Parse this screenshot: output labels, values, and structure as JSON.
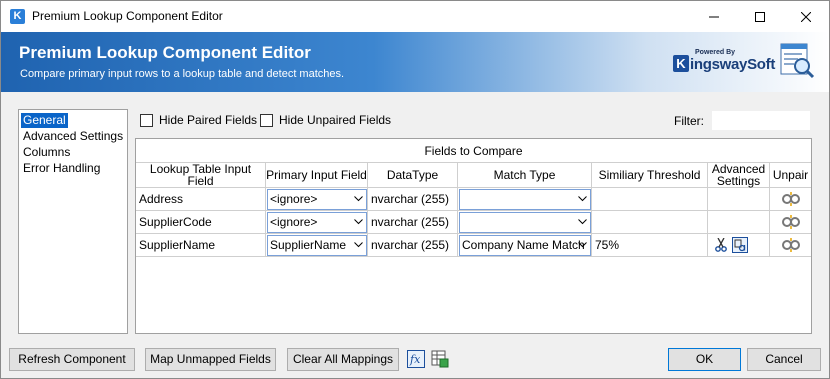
{
  "window": {
    "title": "Premium Lookup Component Editor",
    "app_icon_letter": "K"
  },
  "banner": {
    "title": "Premium Lookup Component Editor",
    "subtitle": "Compare primary input rows to a lookup table and detect matches.",
    "brand_powered": "Powered By",
    "brand_k": "K",
    "brand_name": "ingswaySoft"
  },
  "nav": {
    "items": [
      {
        "label": "General",
        "selected": true
      },
      {
        "label": "Advanced Settings",
        "selected": false
      },
      {
        "label": "Columns",
        "selected": false
      },
      {
        "label": "Error Handling",
        "selected": false
      }
    ]
  },
  "options": {
    "hide_paired_label": "Hide Paired Fields",
    "hide_unpaired_label": "Hide Unpaired Fields",
    "filter_label": "Filter:",
    "filter_value": ""
  },
  "grid": {
    "caption": "Fields to Compare",
    "columns": [
      "Lookup Table Input Field",
      "Primary Input Field",
      "DataType",
      "Match Type",
      "Similiary Threshold",
      "Advanced Settings",
      "Unpair"
    ],
    "rows": [
      {
        "lookup_field": "Address",
        "primary_field": "<ignore>",
        "datatype": "nvarchar (255)",
        "match_type": "",
        "threshold": ""
      },
      {
        "lookup_field": "SupplierCode",
        "primary_field": "<ignore>",
        "datatype": "nvarchar (255)",
        "match_type": "",
        "threshold": ""
      },
      {
        "lookup_field": "SupplierName",
        "primary_field": "SupplierName",
        "datatype": "nvarchar (255)",
        "match_type": "Company Name Match",
        "threshold": "75%"
      }
    ]
  },
  "buttons": {
    "refresh": "Refresh Component",
    "map_unmapped": "Map Unmapped Fields",
    "clear_all": "Clear All Mappings",
    "ok": "OK",
    "cancel": "Cancel"
  },
  "colors": {
    "banner_start": "#1f63b0",
    "selection": "#0a64c8",
    "combo_border": "#7aa0d8"
  }
}
